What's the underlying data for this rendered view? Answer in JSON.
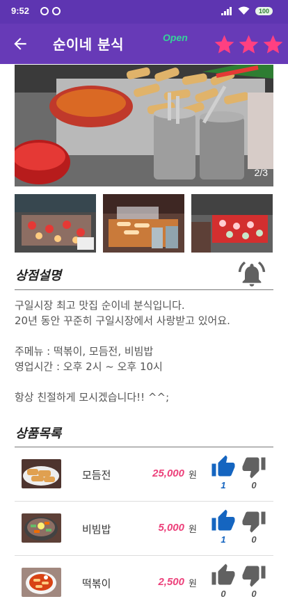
{
  "status_bar": {
    "time": "9:52",
    "battery": "100"
  },
  "app_bar": {
    "title": "순이네 분식",
    "status": "Open",
    "rating": 3
  },
  "gallery": {
    "counter": "2/3"
  },
  "description": {
    "section_title": "상점설명",
    "lines": [
      "구일시장 최고 맛집 순이네 분식입니다.",
      "20년 동안 꾸준히 구일시장에서 사랑받고 있어요.",
      "",
      "주메뉴 : 떡볶이, 모듬전, 비빔밥",
      "영업시간 : 오후 2시 ~ 오후 10시",
      "",
      "항상 친절하게 모시겠습니다!! ^^;"
    ]
  },
  "products": {
    "section_title": "상품목록",
    "unit": "원",
    "items": [
      {
        "name": "모듬전",
        "price": "25,000",
        "likes": "1",
        "dislikes": "0",
        "liked": true
      },
      {
        "name": "비빔밥",
        "price": "5,000",
        "likes": "1",
        "dislikes": "0",
        "liked": true
      },
      {
        "name": "떡볶이",
        "price": "2,500",
        "likes": "0",
        "dislikes": "0",
        "liked": false
      }
    ]
  },
  "colors": {
    "app_bar": "#673ab7",
    "status_bar": "#5e35b1",
    "star": "#ff4081",
    "open": "#34d399",
    "price": "#ec407a",
    "liked": "#1565c0",
    "neutral_thumb": "#616161"
  }
}
